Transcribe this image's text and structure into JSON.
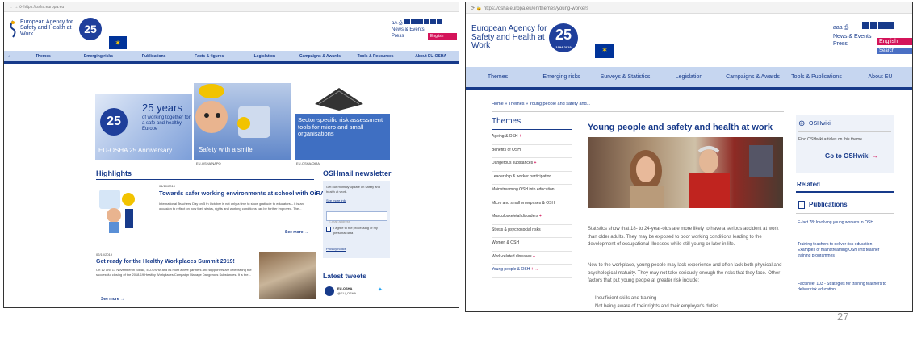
{
  "left": {
    "url": "https://osha.europa.eu",
    "org_name": "European Agency for Safety and Health at Work",
    "badge": "25",
    "nav": [
      "Themes",
      "Emerging risks",
      "Publications",
      "Facts & figures",
      "Legislation",
      "Campaigns & Awards",
      "Tools & Resources",
      "About EU-OSHA"
    ],
    "header_links": [
      "News & Events",
      "Press"
    ],
    "lang": "English",
    "hero": {
      "main_title": "25 years",
      "main_sub": "of working together for a safe and healthy Europe",
      "main_caption": "EU-OSHA 25 Anniversary",
      "tile2_caption": "Safety with a smile",
      "tile3_caption": "Sector-specific risk assessment tools for micro and small organisations",
      "tile2_credit": "EU-OSHA/NAPO",
      "tile3_credit": "EU-OSHA/OiRA"
    },
    "highlights_title": "Highlights",
    "news1": {
      "date": "04/10/2019",
      "title": "Towards safer working environments at school with OiRA",
      "body": "International Teachers' Day on 5 th October is not only a time to show gratitude to educators – it is an occasion to reflect on how their status, rights and working conditions can be further improved. The...",
      "more": "See more"
    },
    "news2": {
      "date": "02/10/2019",
      "title": "Get ready for the Healthy Workplaces Summit 2019!",
      "body": "On 12 and 13 November in Bilbao, EU-OSHA and its most active partners and supporters are celebrating the successful closing of the 2018-19 Healthy Workplaces Campaign Manage Dangerous Substances. It is the...",
      "more": "See more"
    },
    "newsletter": {
      "title": "OSHmail newsletter",
      "text": "Get our monthly update on safety and health at work.",
      "more_info": "See more info",
      "email_placeholder": "E-mail address",
      "consent": "I agree to the processing of my personal data",
      "privacy": "Privacy notice"
    },
    "tweets": {
      "title": "Latest tweets",
      "account": "EU-OSHA",
      "handle": "@EU_OSHA"
    }
  },
  "right": {
    "url": "https://osha.europa.eu/en/themes/young-workers",
    "org_name": "European Agency for Safety and Health at Work",
    "badge": "25",
    "badge_years": "1994-2019",
    "header_links": [
      "News & Events",
      "Press"
    ],
    "lang": "English",
    "search": "Search",
    "nav": [
      "Themes",
      "Emerging risks",
      "Surveys & Statistics",
      "Legislation",
      "Campaigns & Awards",
      "Tools & Publications",
      "About EU"
    ],
    "breadcrumb": "Home » Themes » Young people and safety and...",
    "themes_title": "Themes",
    "themes": [
      {
        "label": "Ageing & OSH",
        "plus": true
      },
      {
        "label": "Benefits of OSH",
        "plus": false
      },
      {
        "label": "Dangerous substances",
        "plus": true
      },
      {
        "label": "Leadership & worker participation",
        "plus": false
      },
      {
        "label": "Mainstreaming OSH into education",
        "plus": false
      },
      {
        "label": "Micro and small enterprises & OSH",
        "plus": false
      },
      {
        "label": "Musculoskeletal disorders",
        "plus": true
      },
      {
        "label": "Stress & psychosocial risks",
        "plus": false
      },
      {
        "label": "Women & OSH",
        "plus": false
      },
      {
        "label": "Work-related diseases",
        "plus": true
      },
      {
        "label": "Young people & OSH",
        "plus": true
      }
    ],
    "article": {
      "title": "Young people and safety and health at work",
      "para1": "Statistics show that 18- to 24-year-olds are more likely to have a serious accident at work than older adults. They may be exposed to poor working conditions leading to the development of occupational illnesses while still young or later in life.",
      "para2": "New to the workplace, young people may lack experience and often lack both physical and psychological maturity. They may not take seriously enough the risks that they face. Other factors that put young people at greater risk include:",
      "bullets": [
        "Insufficient skills and training",
        "Not being aware of their rights and their employer's duties"
      ]
    },
    "oshwiki": {
      "title": "OSHwiki",
      "text": "Find OSHwiki articles on this theme",
      "link": "Go to OSHwiki"
    },
    "related": {
      "title": "Related",
      "pubs_title": "Publications",
      "items": [
        "E-fact 78: Involving young workers in OSH",
        "Training teachers to deliver risk education - Examples of mainstreaming OSH into teacher training programmes",
        "Factsheet 103 - Strategies for training teachers to deliver risk education"
      ]
    }
  },
  "page_number": "27",
  "colors": {
    "brand_blue": "#173a8a",
    "nav_bg": "#c6d6f0",
    "accent_pink": "#d4145a"
  }
}
